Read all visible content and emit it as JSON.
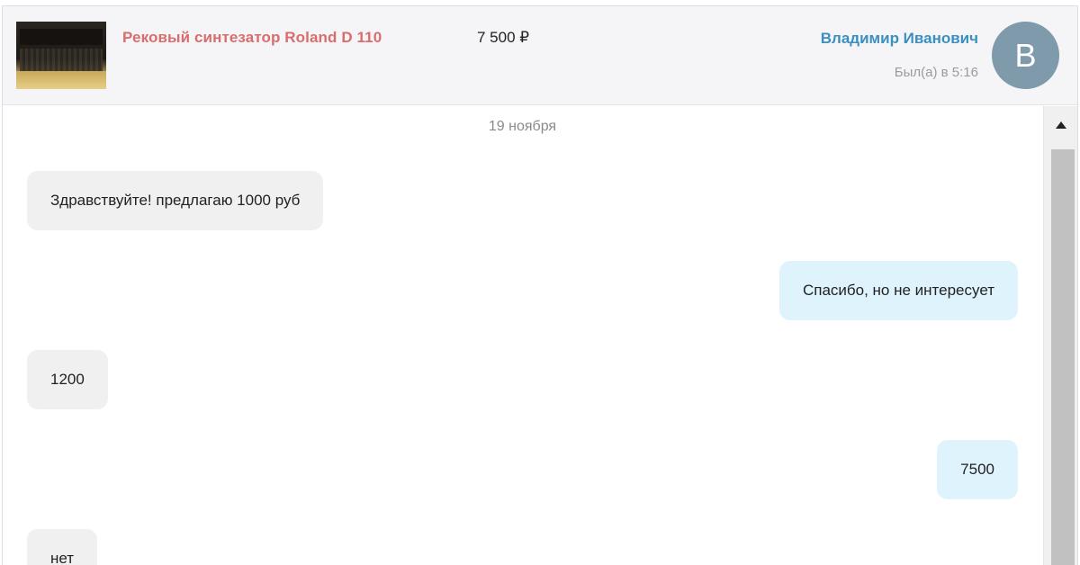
{
  "listing": {
    "title": "Рековый синтезатор Roland D 110",
    "price": "7 500 ₽",
    "thumbnail_icon": "synthesizer-photo"
  },
  "contact": {
    "name": "Владимир Иванович",
    "status": "Был(а) в 5:16",
    "avatar_letter": "В",
    "avatar_color": "#7f9aab"
  },
  "chat": {
    "date": "19 ноября",
    "messages": [
      {
        "direction": "incoming",
        "text": "Здравствуйте! предлагаю 1000 руб"
      },
      {
        "direction": "outgoing",
        "text": "Спасибо, но не интересует"
      },
      {
        "direction": "incoming",
        "text": "1200"
      },
      {
        "direction": "outgoing",
        "text": "7500"
      },
      {
        "direction": "incoming",
        "text": "нет"
      }
    ]
  },
  "colors": {
    "title": "#d96d6d",
    "name": "#3a8fc0",
    "incoming_bubble": "#f0f0f0",
    "outgoing_bubble": "#dff3fd"
  }
}
